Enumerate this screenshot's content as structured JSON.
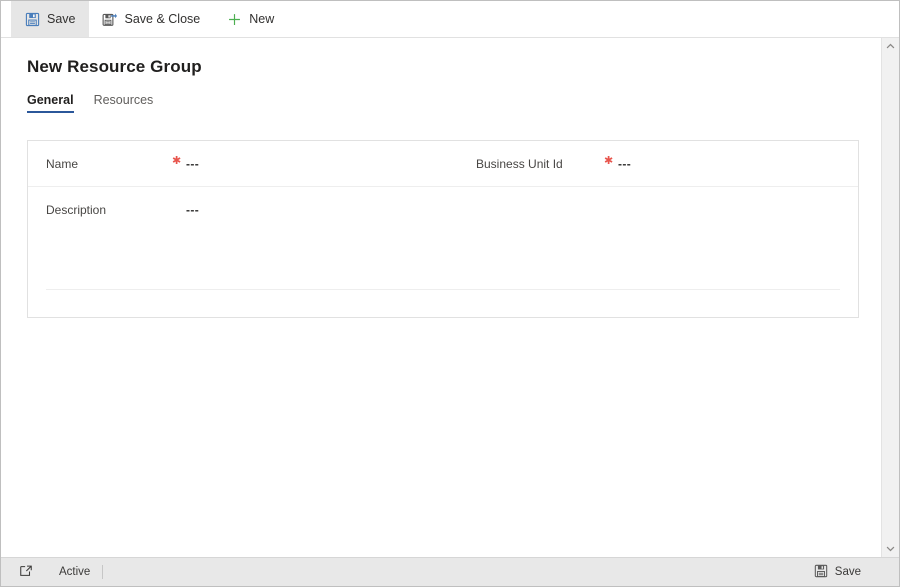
{
  "theme": {
    "accent": "#2b579a",
    "required_star": "#e8554d",
    "new_icon_green": "#4caf50",
    "save_icon_blue": "#4a7ebb",
    "command_bar_active_bg": "#e6e6e6",
    "status_bar_bg": "#e8e8e8",
    "page_bg": "#ffffff"
  },
  "command_bar": {
    "buttons": [
      {
        "label": "Save",
        "icon": "save-floppy-icon",
        "active": true
      },
      {
        "label": "Save & Close",
        "icon": "save-and-close-floppy-icon",
        "active": false
      },
      {
        "label": "New",
        "icon": "plus-icon",
        "active": false
      }
    ]
  },
  "page": {
    "title": "New Resource Group"
  },
  "tabs": [
    {
      "label": "General",
      "selected": true
    },
    {
      "label": "Resources",
      "selected": false
    }
  ],
  "form": {
    "rows": [
      {
        "left": {
          "label": "Name",
          "required": true,
          "value": "---"
        },
        "right": {
          "label": "Business Unit Id",
          "required": true,
          "value": "---"
        }
      },
      {
        "left": {
          "label": "Description",
          "required": false,
          "value": "---"
        },
        "right": null
      }
    ]
  },
  "scrollbar": {
    "up_icon": "chevron-up-icon",
    "down_icon": "chevron-down-icon"
  },
  "status_bar": {
    "popout_icon": "open-in-new-window-icon",
    "state": "Active",
    "save_label": "Save",
    "save_icon": "save-floppy-icon"
  }
}
